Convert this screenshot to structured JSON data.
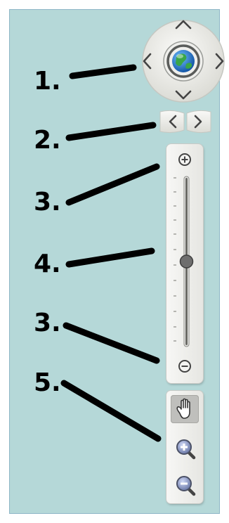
{
  "callouts": {
    "c1": "1.",
    "c2": "2.",
    "c3a": "3.",
    "c4": "4.",
    "c3b": "3.",
    "c5": "5."
  },
  "colors": {
    "background": "#b5d8d8",
    "frame_border": "#8fb7c7",
    "control_fill": "#eeeeea",
    "globe_blue": "#2f7fd8",
    "globe_green": "#3aa648",
    "slider_knob": "#6e6e6e"
  },
  "icons": {
    "pan_up": "chevron-up-icon",
    "pan_down": "chevron-down-icon",
    "pan_left": "chevron-left-icon",
    "pan_right": "chevron-right-icon",
    "center": "globe-icon",
    "rotate_left": "chevron-left-icon",
    "rotate_right": "chevron-right-icon",
    "zoom_in": "plus-circle-icon",
    "zoom_out": "minus-circle-icon",
    "pan_tool": "hand-icon",
    "zoom_in_tool": "magnifier-plus-icon",
    "zoom_out_tool": "magnifier-minus-icon"
  },
  "zoom_slider": {
    "level": 0.5
  }
}
